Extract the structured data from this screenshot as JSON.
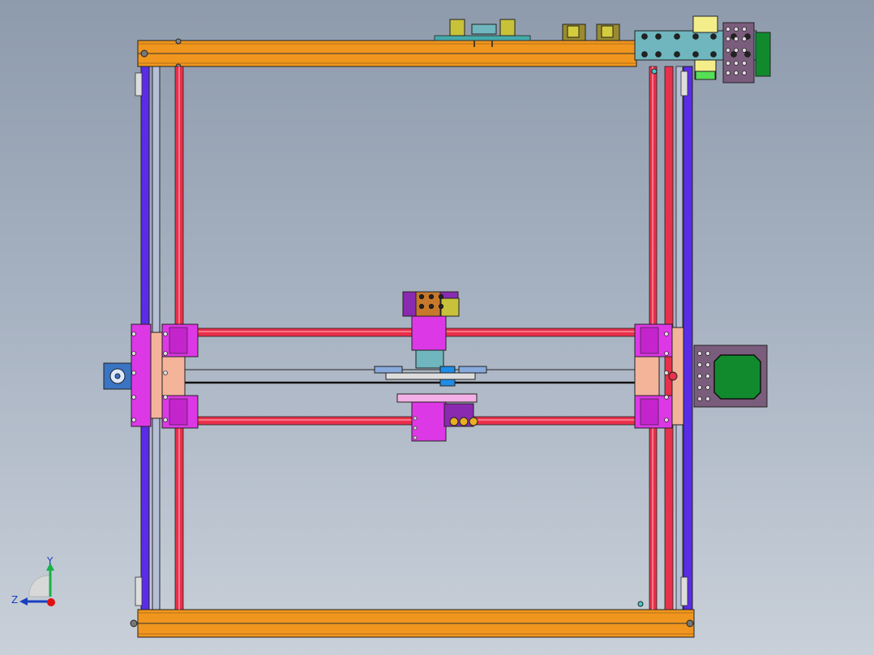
{
  "viewport": {
    "background_top": "#8e9bac",
    "background_bottom": "#c9d0d9"
  },
  "colors": {
    "frame_orange": "#f0961e",
    "rail_blue": "#5a2ce6",
    "rod_red": "#e8304a",
    "carriage_magenta": "#dd38e6",
    "bearing_pink": "#f4b49a",
    "plate_teal": "#6fb6be",
    "motor_green": "#118a2e",
    "motor_housing": "#7a5c7c",
    "pcb_olive": "#c8c23a",
    "belt_black": "#111111"
  },
  "triad": {
    "y_label": "Y",
    "z_label": "Z",
    "y_axis_color": "#19b24a",
    "z_axis_color": "#1a3fbf",
    "origin_color": "#e01010"
  }
}
